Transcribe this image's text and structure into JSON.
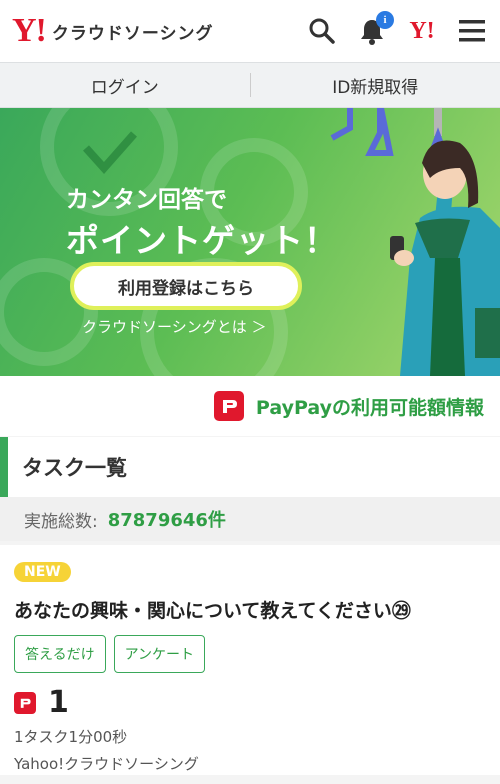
{
  "header": {
    "logo_mark": "Y!",
    "logo_text": "クラウドソーシング",
    "notification_badge": "i",
    "yahoo_mark": "Y!"
  },
  "auth": {
    "login": "ログイン",
    "signup": "ID新規取得"
  },
  "banner": {
    "line1": "カンタン回答で",
    "line2": "ポイントゲット！",
    "register_button": "利用登録はこちら",
    "about_link": "クラウドソーシングとは ＞"
  },
  "paypay": {
    "label": "PayPayの利用可能額情報"
  },
  "tasks": {
    "heading": "タスク一覧",
    "total_label": "実施総数:",
    "total_value": "87879646件"
  },
  "task_card": {
    "badge": "NEW",
    "title": "あなたの興味・関心について教えてください㉙",
    "tags": [
      "答えるだけ",
      "アンケート"
    ],
    "reward": "1",
    "duration": "1タスク1分00秒",
    "provider": "Yahoo!クラウドソーシング"
  },
  "colors": {
    "brand_red": "#e0182d",
    "accent_green": "#2f9e45",
    "new_yellow": "#f6d337"
  }
}
